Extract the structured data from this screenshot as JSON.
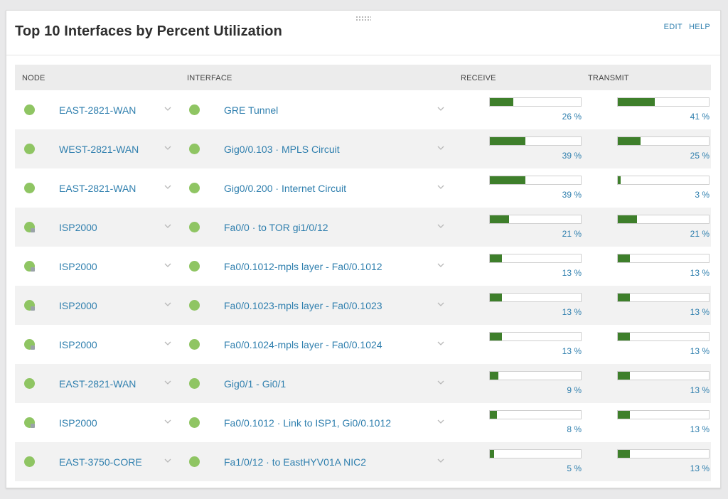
{
  "widget": {
    "title": "Top 10 Interfaces by Percent Utilization",
    "edit_label": "EDIT",
    "help_label": "HELP"
  },
  "columns": {
    "node": "NODE",
    "interface": "INTERFACE",
    "receive": "RECEIVE",
    "transmit": "TRANSMIT"
  },
  "colors": {
    "status_up": "#8fc563",
    "bar_fill": "#3e7f2b",
    "link": "#2f7fae"
  },
  "rows": [
    {
      "node": "EAST-2821-WAN",
      "node_status": "up",
      "interface": "GRE Tunnel",
      "interface_status": "up",
      "receive": 26,
      "receive_label": "26 %",
      "transmit": 41,
      "transmit_label": "41 %"
    },
    {
      "node": "WEST-2821-WAN",
      "node_status": "up",
      "interface": "Gig0/0.103 · MPLS Circuit",
      "interface_status": "up",
      "receive": 39,
      "receive_label": "39 %",
      "transmit": 25,
      "transmit_label": "25 %"
    },
    {
      "node": "EAST-2821-WAN",
      "node_status": "up",
      "interface": "Gig0/0.200 · Internet Circuit",
      "interface_status": "up",
      "receive": 39,
      "receive_label": "39 %",
      "transmit": 3,
      "transmit_label": "3 %"
    },
    {
      "node": "ISP2000",
      "node_status": "partial",
      "interface": "Fa0/0 · to TOR gi1/0/12",
      "interface_status": "up",
      "receive": 21,
      "receive_label": "21 %",
      "transmit": 21,
      "transmit_label": "21 %"
    },
    {
      "node": "ISP2000",
      "node_status": "partial",
      "interface": "Fa0/0.1012-mpls layer - Fa0/0.1012",
      "interface_status": "up",
      "receive": 13,
      "receive_label": "13 %",
      "transmit": 13,
      "transmit_label": "13 %"
    },
    {
      "node": "ISP2000",
      "node_status": "partial",
      "interface": "Fa0/0.1023-mpls layer - Fa0/0.1023",
      "interface_status": "up",
      "receive": 13,
      "receive_label": "13 %",
      "transmit": 13,
      "transmit_label": "13 %"
    },
    {
      "node": "ISP2000",
      "node_status": "partial",
      "interface": "Fa0/0.1024-mpls layer - Fa0/0.1024",
      "interface_status": "up",
      "receive": 13,
      "receive_label": "13 %",
      "transmit": 13,
      "transmit_label": "13 %"
    },
    {
      "node": "EAST-2821-WAN",
      "node_status": "up",
      "interface": "Gig0/1 - Gi0/1",
      "interface_status": "up",
      "receive": 9,
      "receive_label": "9 %",
      "transmit": 13,
      "transmit_label": "13 %"
    },
    {
      "node": "ISP2000",
      "node_status": "partial",
      "interface": "Fa0/0.1012 · Link to ISP1, Gi0/0.1012",
      "interface_status": "up",
      "receive": 8,
      "receive_label": "8 %",
      "transmit": 13,
      "transmit_label": "13 %"
    },
    {
      "node": "EAST-3750-CORE",
      "node_status": "up",
      "interface": "Fa1/0/12 · to EastHYV01A NIC2",
      "interface_status": "up",
      "receive": 5,
      "receive_label": "5 %",
      "transmit": 13,
      "transmit_label": "13 %"
    }
  ]
}
